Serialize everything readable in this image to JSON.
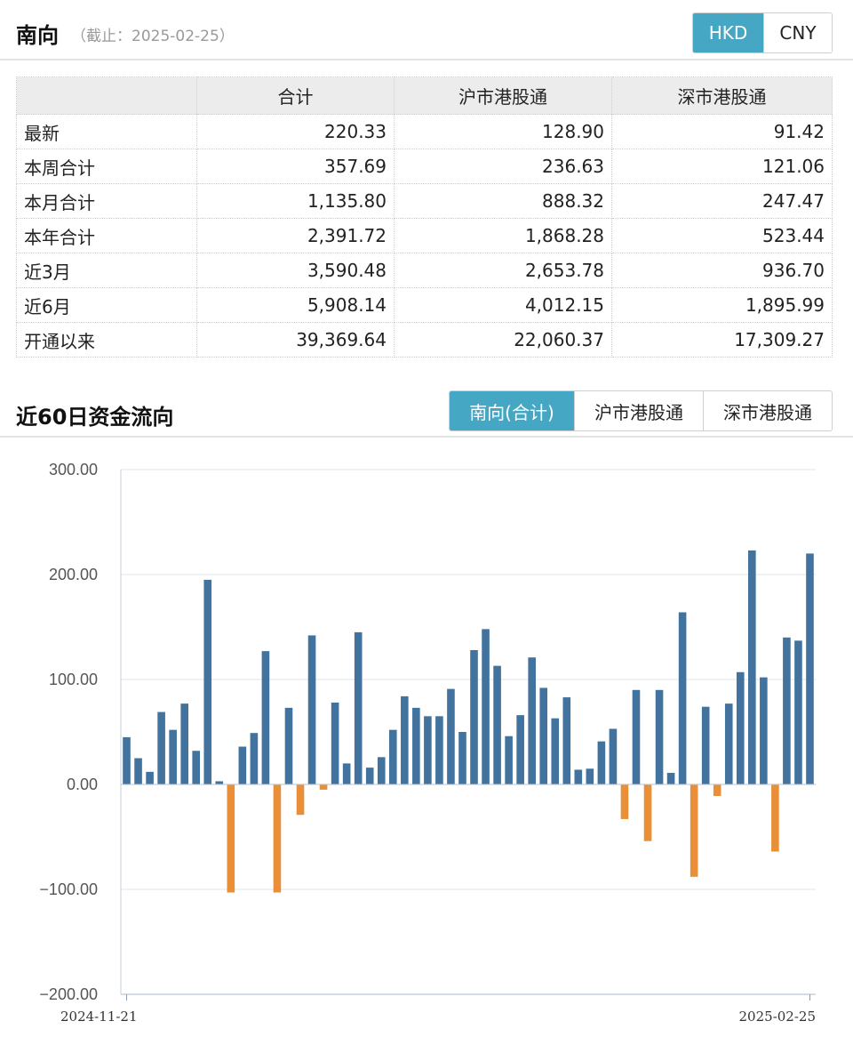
{
  "header": {
    "title": "南向",
    "subtitle": "（截止：2025-02-25）",
    "currency_options": [
      "HKD",
      "CNY"
    ],
    "currency_selected": "HKD"
  },
  "table": {
    "columns": [
      "",
      "合计",
      "沪市港股通",
      "深市港股通"
    ],
    "rows": [
      {
        "label": "最新",
        "values": [
          "220.33",
          "128.90",
          "91.42"
        ]
      },
      {
        "label": "本周合计",
        "values": [
          "357.69",
          "236.63",
          "121.06"
        ]
      },
      {
        "label": "本月合计",
        "values": [
          "1,135.80",
          "888.32",
          "247.47"
        ]
      },
      {
        "label": "本年合计",
        "values": [
          "2,391.72",
          "1,868.28",
          "523.44"
        ]
      },
      {
        "label": "近3月",
        "values": [
          "3,590.48",
          "2,653.78",
          "936.70"
        ]
      },
      {
        "label": "近6月",
        "values": [
          "5,908.14",
          "4,012.15",
          "1,895.99"
        ]
      },
      {
        "label": "开通以来",
        "values": [
          "39,369.64",
          "22,060.37",
          "17,309.27"
        ]
      }
    ]
  },
  "section": {
    "title": "近60日资金流向",
    "market_options": [
      "南向(合计)",
      "沪市港股通",
      "深市港股通"
    ],
    "market_selected": "南向(合计)"
  },
  "chart_data": {
    "type": "bar",
    "x_start_label": "2024-11-21",
    "x_end_label": "2025-02-25",
    "y_tick_labels": [
      "300.00",
      "200.00",
      "100.00",
      "0.00",
      "−100.00",
      "−200.00"
    ],
    "ylim": [
      -200,
      300
    ],
    "grid": true,
    "colors": {
      "positive": "#41739e",
      "negative": "#e98f38"
    },
    "values": [
      45,
      25,
      12,
      69,
      52,
      77,
      32,
      195,
      3,
      -103,
      36,
      49,
      127,
      -103,
      73,
      -29,
      142,
      -5,
      78,
      20,
      145,
      16,
      26,
      52,
      84,
      73,
      65,
      65,
      91,
      50,
      128,
      148,
      113,
      46,
      66,
      121,
      92,
      63,
      83,
      14,
      15,
      41,
      53,
      -33,
      90,
      -54,
      90,
      11,
      164,
      -88,
      74,
      -11,
      77,
      107,
      223,
      102,
      -64,
      140,
      137,
      220
    ]
  }
}
